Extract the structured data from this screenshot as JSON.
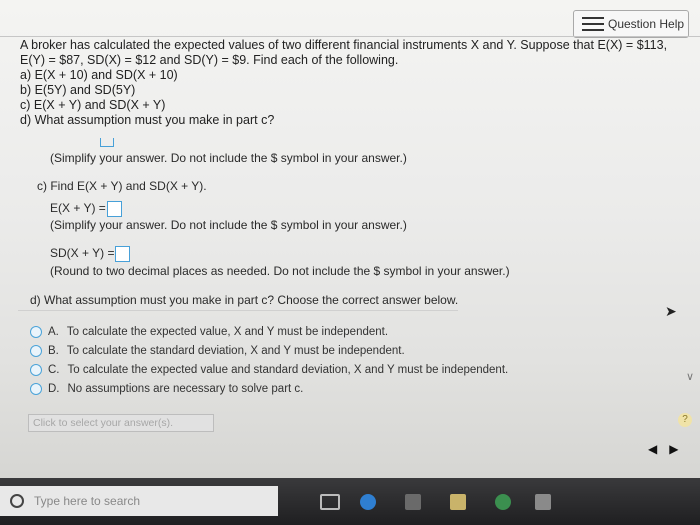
{
  "header": {
    "help_label": "Question Help"
  },
  "question": {
    "lines": [
      "A broker has calculated the expected values of two different financial instruments X and Y. Suppose that E(X) = $113,",
      "E(Y) = $87, SD(X) = $12 and SD(Y) = $9. Find each of the following.",
      "a) E(X + 10) and SD(X + 10)",
      "b) E(5Y) and SD(5Y)",
      "c) E(X + Y) and SD(X + Y)",
      "d) What assumption must you make in part c?"
    ]
  },
  "part_b": {
    "note": "(Simplify your answer. Do not include the $ symbol in your answer.)"
  },
  "part_c": {
    "heading": "c) Find E(X + Y) and SD(X + Y).",
    "e_label": "E(X + Y) =",
    "e_note": "(Simplify your answer. Do not include the $ symbol in your answer.)",
    "sd_label": "SD(X + Y) =",
    "sd_note": "(Round to two decimal places as needed. Do not include the $ symbol in your answer.)"
  },
  "part_d": {
    "heading": "d) What assumption must you make in part c? Choose the correct answer below.",
    "options": [
      {
        "letter": "A.",
        "text": "To calculate the expected value, X and Y must be independent."
      },
      {
        "letter": "B.",
        "text": "To calculate the standard deviation, X and Y must be independent."
      },
      {
        "letter": "C.",
        "text": "To calculate the expected value and standard deviation, X and Y must be independent."
      },
      {
        "letter": "D.",
        "text": "No assumptions are necessary to solve part c."
      }
    ]
  },
  "footer": {
    "select_hint": "Click to select your answer(s).",
    "help_glyph": "?"
  },
  "taskbar": {
    "search_placeholder": "Type here to search"
  },
  "colors": {
    "accent": "#47a0d8",
    "taskbar": "#2b2b2d"
  },
  "icons": [
    "list-icon",
    "search-icon",
    "edge-icon",
    "store-icon",
    "file-explorer-icon"
  ]
}
